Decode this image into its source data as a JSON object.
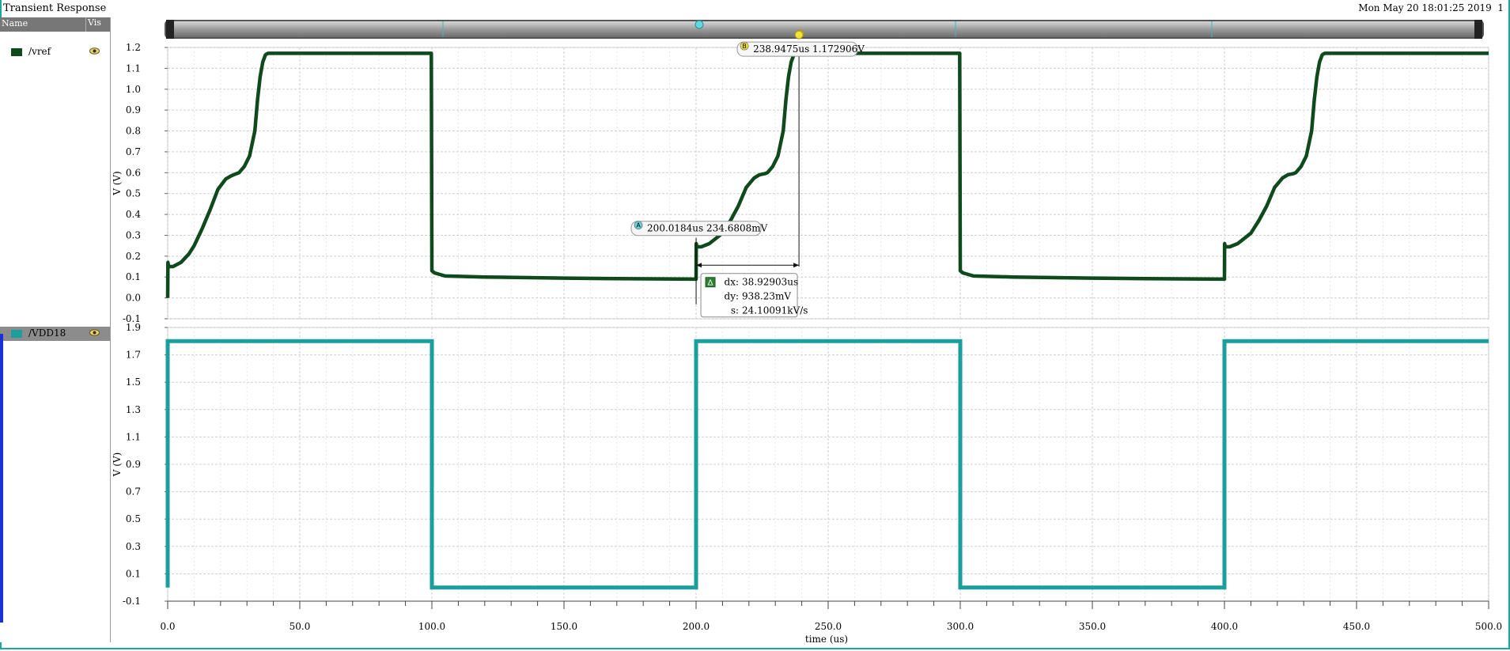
{
  "window": {
    "title": "Transient Response",
    "datestamp": "Mon May 20 18:01:25 2019",
    "page_number": "1"
  },
  "legend_panel": {
    "header_name": "Name",
    "header_vis": "Vis",
    "signals": [
      {
        "name": "/vref",
        "color": "#0e4a1c",
        "icon": "eye-icon"
      },
      {
        "name": "/VDD18",
        "color": "#1a9e9e",
        "icon": "eye-icon"
      }
    ]
  },
  "markers": {
    "A": {
      "letter": "A",
      "label": "200.0184us 234.6808mV",
      "color": "#63d8e0"
    },
    "B": {
      "letter": "B",
      "label": "238.9475us 1.172906V",
      "color": "#f2e23a"
    },
    "delta": {
      "symbol": "Δ",
      "dx_key": "dx:",
      "dx": "38.92903us",
      "dy_key": "dy:",
      "dy": "938.23mV",
      "s_key": "s:",
      "s": "24.10091kV/s"
    }
  },
  "chart_data": [
    {
      "type": "line",
      "ylabel": "V (V)",
      "ylim": [
        -0.1,
        1.2
      ],
      "yticks": [
        "-0.1",
        "0.0",
        "0.1",
        "0.2",
        "0.3",
        "0.4",
        "0.5",
        "0.6",
        "0.7",
        "0.8",
        "0.9",
        "1.0",
        "1.1",
        "1.2"
      ],
      "grid": true,
      "series": [
        {
          "name": "/vref",
          "color": "#0e4a1c",
          "x": [
            0,
            0.1,
            0.3,
            2,
            5,
            8,
            10,
            13,
            16,
            19,
            22,
            24,
            26,
            27,
            29,
            31,
            33,
            34,
            35,
            36,
            37,
            38,
            40,
            60,
            80,
            99.8,
            100,
            101,
            105,
            120,
            150,
            170,
            200,
            200.05,
            200.3,
            202,
            205,
            208,
            210,
            213,
            216,
            219,
            222,
            224,
            226,
            227,
            229,
            231,
            233,
            234,
            235,
            236,
            237,
            238,
            240,
            260,
            280,
            299.8,
            300,
            301,
            305,
            320,
            350,
            370,
            400,
            400.05,
            400.3,
            402,
            405,
            408,
            410,
            413,
            416,
            419,
            422,
            424,
            426,
            427,
            429,
            431,
            433,
            434,
            435,
            436,
            437,
            438,
            440,
            460,
            480,
            500
          ],
          "y": [
            0.0,
            0.17,
            0.15,
            0.15,
            0.17,
            0.21,
            0.25,
            0.33,
            0.42,
            0.52,
            0.57,
            0.585,
            0.595,
            0.6,
            0.63,
            0.68,
            0.8,
            0.95,
            1.06,
            1.13,
            1.165,
            1.172,
            1.172,
            1.172,
            1.172,
            1.172,
            0.13,
            0.12,
            0.105,
            0.1,
            0.095,
            0.092,
            0.09,
            0.26,
            0.245,
            0.245,
            0.26,
            0.29,
            0.31,
            0.37,
            0.44,
            0.53,
            0.575,
            0.59,
            0.595,
            0.6,
            0.63,
            0.68,
            0.8,
            0.95,
            1.06,
            1.13,
            1.165,
            1.172,
            1.172,
            1.172,
            1.172,
            1.172,
            0.13,
            0.12,
            0.105,
            0.1,
            0.095,
            0.092,
            0.09,
            0.26,
            0.245,
            0.245,
            0.26,
            0.29,
            0.31,
            0.37,
            0.44,
            0.53,
            0.575,
            0.59,
            0.595,
            0.6,
            0.63,
            0.68,
            0.8,
            0.95,
            1.06,
            1.13,
            1.165,
            1.172,
            1.172,
            1.172,
            1.172,
            1.172
          ]
        }
      ]
    },
    {
      "type": "line",
      "ylabel": "V (V)",
      "xlabel": "time (us)",
      "ylim": [
        -0.1,
        1.9
      ],
      "xlim": [
        0,
        500
      ],
      "yticks": [
        "-0.1",
        "0.1",
        "0.3",
        "0.5",
        "0.7",
        "0.9",
        "1.1",
        "1.3",
        "1.5",
        "1.7",
        "1.9"
      ],
      "xticks": [
        "0.0",
        "50.0",
        "100.0",
        "150.0",
        "200.0",
        "250.0",
        "300.0",
        "350.0",
        "400.0",
        "450.0",
        "500.0"
      ],
      "grid": true,
      "series": [
        {
          "name": "/VDD18",
          "color": "#1a9e9e",
          "x": [
            0,
            0.01,
            100,
            100.01,
            200,
            200.01,
            300,
            300.01,
            400,
            400.01,
            500
          ],
          "y": [
            0.0,
            1.8,
            1.8,
            0.0,
            0.0,
            1.8,
            1.8,
            0.0,
            0.0,
            1.8,
            1.8
          ]
        }
      ]
    }
  ]
}
